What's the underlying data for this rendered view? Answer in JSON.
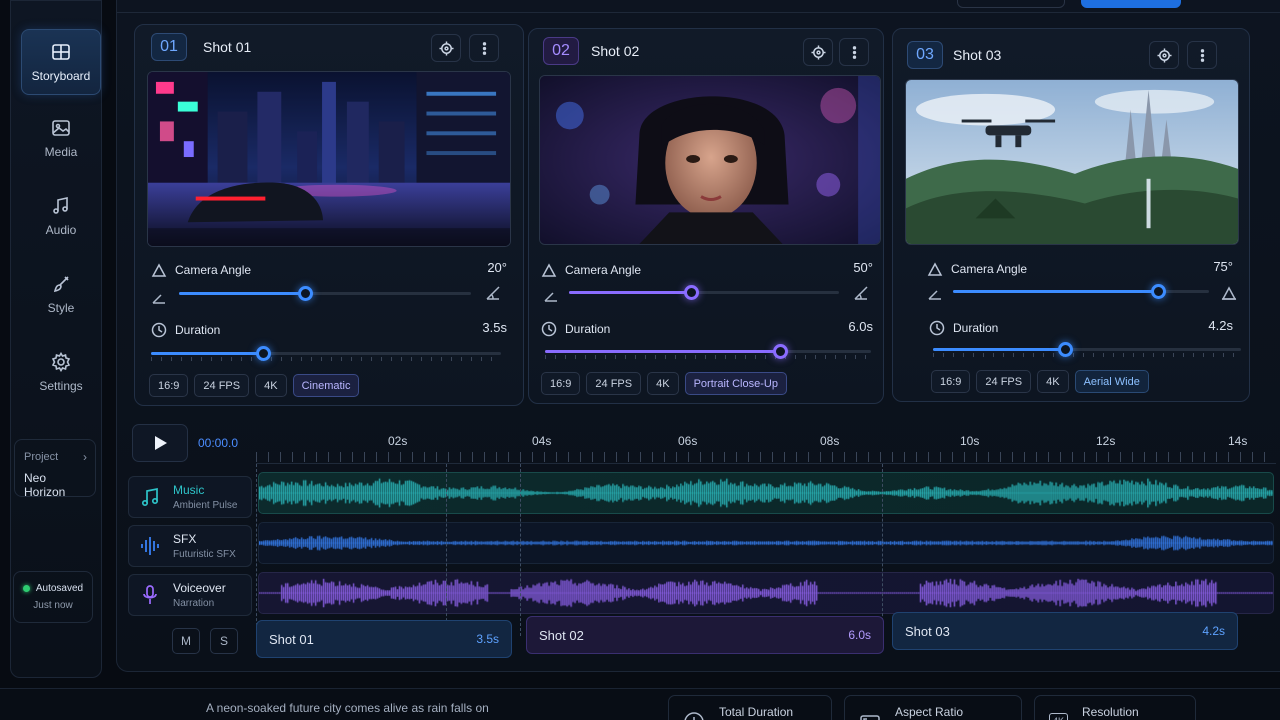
{
  "sidebar": {
    "items": [
      {
        "label": "Storyboard",
        "icon": "storyboard-icon",
        "active": true
      },
      {
        "label": "Media",
        "icon": "image-icon"
      },
      {
        "label": "Audio",
        "icon": "music-note-icon"
      },
      {
        "label": "Style",
        "icon": "brush-icon"
      },
      {
        "label": "Settings",
        "icon": "gear-icon"
      }
    ],
    "project": {
      "label": "Project",
      "name": "Neo Horizon"
    },
    "autosave": {
      "status": "Autosaved",
      "time": "Just now"
    }
  },
  "shots": [
    {
      "num": "01",
      "title": "Shot 01",
      "angle_label": "Camera Angle",
      "angle": "20°",
      "angle_pct": 0.43,
      "duration_label": "Duration",
      "duration": "3.5s",
      "duration_pct": 0.32,
      "tags": [
        "16:9",
        "24 FPS",
        "4K",
        "Cinematic"
      ],
      "scene": "neon-city-car"
    },
    {
      "num": "02",
      "title": "Shot 02",
      "angle_label": "Camera Angle",
      "angle": "50°",
      "angle_pct": 0.45,
      "duration_label": "Duration",
      "duration": "6.0s",
      "duration_pct": 0.72,
      "tags": [
        "16:9",
        "24 FPS",
        "4K",
        "Portrait Close-Up"
      ],
      "scene": "portrait-woman"
    },
    {
      "num": "03",
      "title": "Shot 03",
      "angle_label": "Camera Angle",
      "angle": "75°",
      "angle_pct": 0.8,
      "duration_label": "Duration",
      "duration": "4.2s",
      "duration_pct": 0.43,
      "tags": [
        "16:9",
        "24 FPS",
        "4K",
        "Aerial Wide"
      ],
      "scene": "drone-fantasy-valley"
    }
  ],
  "timeline": {
    "timecode": "00:00.0",
    "ruler": [
      "02s",
      "04s",
      "06s",
      "08s",
      "10s",
      "12s",
      "14s"
    ],
    "tracks": [
      {
        "name": "Music",
        "sub": "Ambient Pulse",
        "color": "#2ec4c9"
      },
      {
        "name": "SFX",
        "sub": "Futuristic SFX",
        "color": "#3a86ff"
      },
      {
        "name": "Voiceover",
        "sub": "Narration",
        "color": "#9b6bff"
      }
    ],
    "mute_label": "M",
    "solo_label": "S",
    "clips": [
      {
        "name": "Shot 01",
        "dur": "3.5s"
      },
      {
        "name": "Shot 02",
        "dur": "6.0s"
      },
      {
        "name": "Shot 03",
        "dur": "4.2s"
      }
    ]
  },
  "bottom": {
    "description": "A neon-soaked future city comes alive as rain falls on",
    "stats": [
      {
        "label": "Total Duration",
        "icon": "clock-icon"
      },
      {
        "label": "Aspect Ratio",
        "icon": "aspect-ratio-icon"
      },
      {
        "label": "Resolution",
        "icon": "4k-icon",
        "badge": "4K"
      }
    ]
  }
}
